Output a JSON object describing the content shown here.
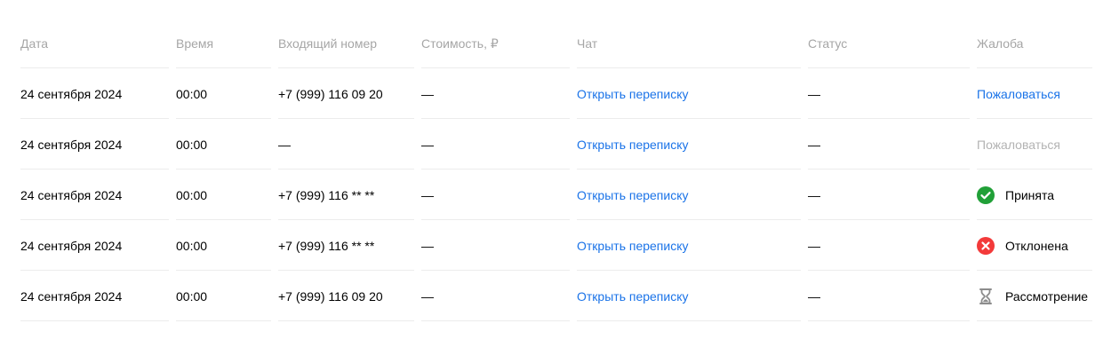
{
  "headers": {
    "date": "Дата",
    "time": "Время",
    "incoming_number": "Входящий номер",
    "cost": "Стоимость, ₽",
    "chat": "Чат",
    "status": "Статус",
    "complaint": "Жалоба"
  },
  "rows": [
    {
      "date": "24 сентября 2024",
      "time": "00:00",
      "number": "+7 (999) 116 09 20",
      "cost": "—",
      "chat": "Открыть переписку",
      "status": "—",
      "complaint": {
        "type": "link",
        "text": "Пожаловаться"
      }
    },
    {
      "date": "24 сентября 2024",
      "time": "00:00",
      "number": "—",
      "cost": "—",
      "chat": "Открыть переписку",
      "status": "—",
      "complaint": {
        "type": "disabled",
        "text": "Пожаловаться"
      }
    },
    {
      "date": "24 сентября 2024",
      "time": "00:00",
      "number": "+7 (999) 116 ** **",
      "cost": "—",
      "chat": "Открыть переписку",
      "status": "—",
      "complaint": {
        "type": "accepted",
        "text": "Принята",
        "icon": "check-circle-icon",
        "color": "#21a038"
      }
    },
    {
      "date": "24 сентября 2024",
      "time": "00:00",
      "number": "+7 (999) 116 ** **",
      "cost": "—",
      "chat": "Открыть переписку",
      "status": "—",
      "complaint": {
        "type": "rejected",
        "text": "Отклонена",
        "icon": "cross-circle-icon",
        "color": "#f33a3a"
      }
    },
    {
      "date": "24 сентября 2024",
      "time": "00:00",
      "number": "+7 (999) 116 09 20",
      "cost": "—",
      "chat": "Открыть переписку",
      "status": "—",
      "complaint": {
        "type": "review",
        "text": "Рассмотрение",
        "icon": "hourglass-icon",
        "color": "#8c8c8c"
      }
    }
  ],
  "colors": {
    "link": "#1a73e8",
    "header_text": "#a6a6a6",
    "disabled_link": "#b3b3b3",
    "divider": "#ececec"
  }
}
